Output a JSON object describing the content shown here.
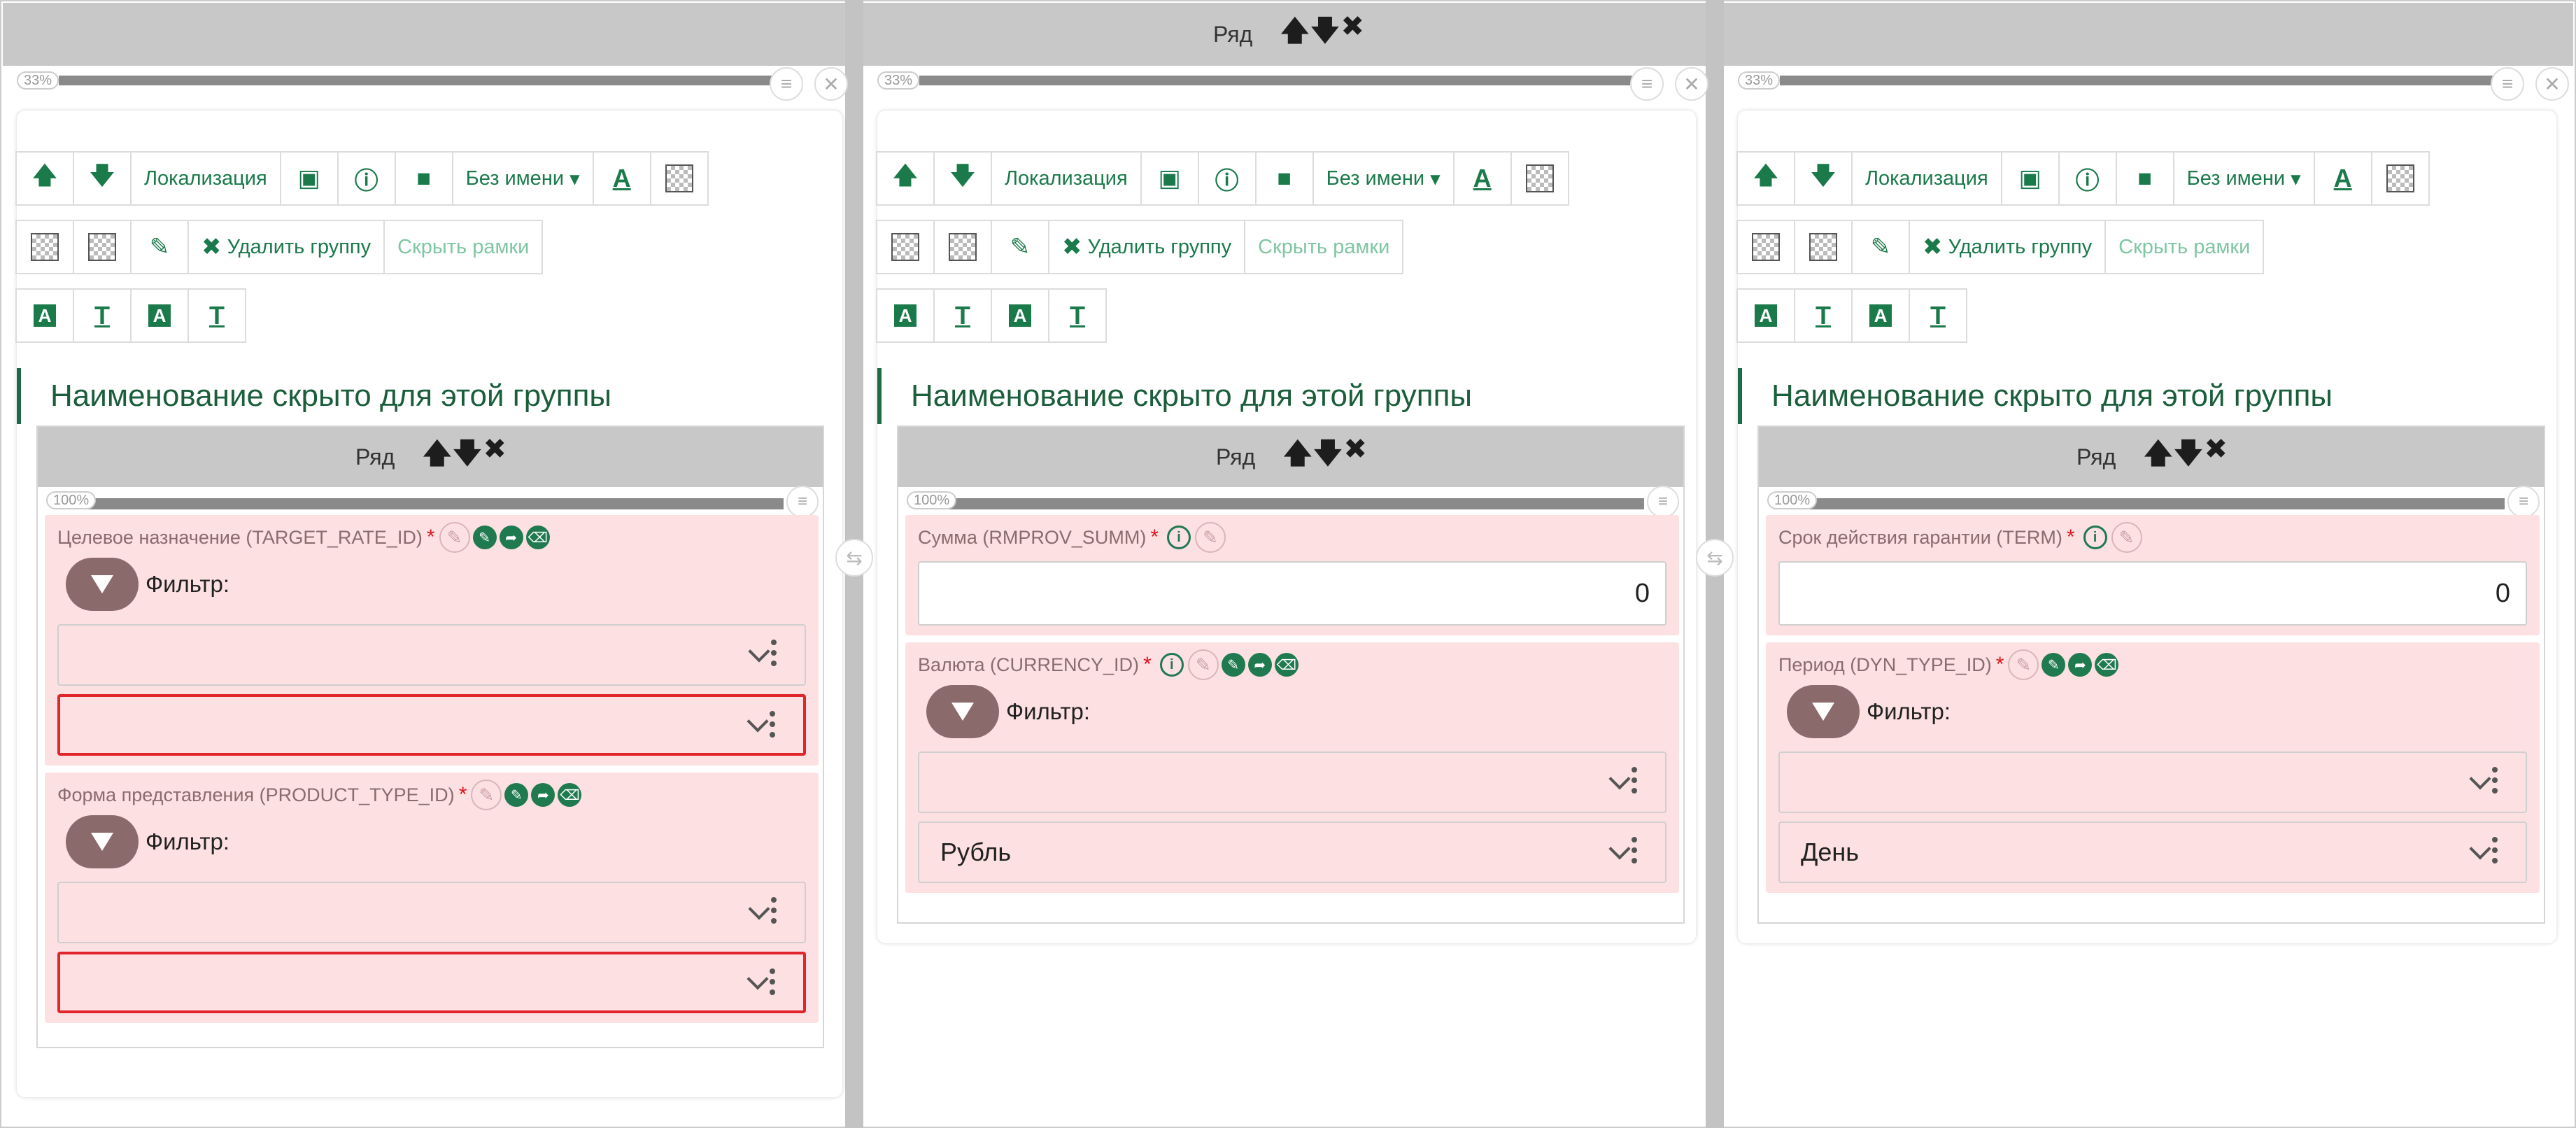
{
  "top_row": {
    "label": "Ряд"
  },
  "columns": [
    {
      "percent": "33%",
      "toolbar": {
        "localization": "Локализация",
        "no_name": "Без имени",
        "delete_group": "Удалить группу",
        "hide_frames": "Скрыть рамки"
      },
      "group_title": "Наименование скрыто для этой группы",
      "inner_row": {
        "label": "Ряд",
        "percent": "100%"
      },
      "fields": [
        {
          "label": "Целевое назначение (TARGET_RATE_ID)",
          "required": "*",
          "filter_label": "Фильтр:",
          "value": ""
        },
        {
          "label": "Форма представления (PRODUCT_TYPE_ID)",
          "required": "*",
          "filter_label": "Фильтр:",
          "value": ""
        }
      ]
    },
    {
      "percent": "33%",
      "toolbar": {
        "localization": "Локализация",
        "no_name": "Без имени",
        "delete_group": "Удалить группу",
        "hide_frames": "Скрыть рамки"
      },
      "group_title": "Наименование скрыто для этой группы",
      "inner_row": {
        "label": "Ряд",
        "percent": "100%"
      },
      "fields": [
        {
          "label": "Сумма (RMPROV_SUMM)",
          "required": "*",
          "value": "0"
        },
        {
          "label": "Валюта (CURRENCY_ID)",
          "required": "*",
          "filter_label": "Фильтр:",
          "value": "Рубль"
        }
      ]
    },
    {
      "percent": "33%",
      "toolbar": {
        "localization": "Локализация",
        "no_name": "Без имени",
        "delete_group": "Удалить группу",
        "hide_frames": "Скрыть рамки"
      },
      "group_title": "Наименование скрыто для этой группы",
      "inner_row": {
        "label": "Ряд",
        "percent": "100%"
      },
      "fields": [
        {
          "label": "Срок действия гарантии (TERM)",
          "required": "*",
          "value": "0"
        },
        {
          "label": "Период (DYN_TYPE_ID)",
          "required": "*",
          "filter_label": "Фильтр:",
          "value": "День"
        }
      ]
    }
  ],
  "colors": {
    "accent": "#1a7a4a",
    "field_bg": "#fde0e2",
    "error": "#e0252b",
    "row_header": "#c8c8c8"
  }
}
